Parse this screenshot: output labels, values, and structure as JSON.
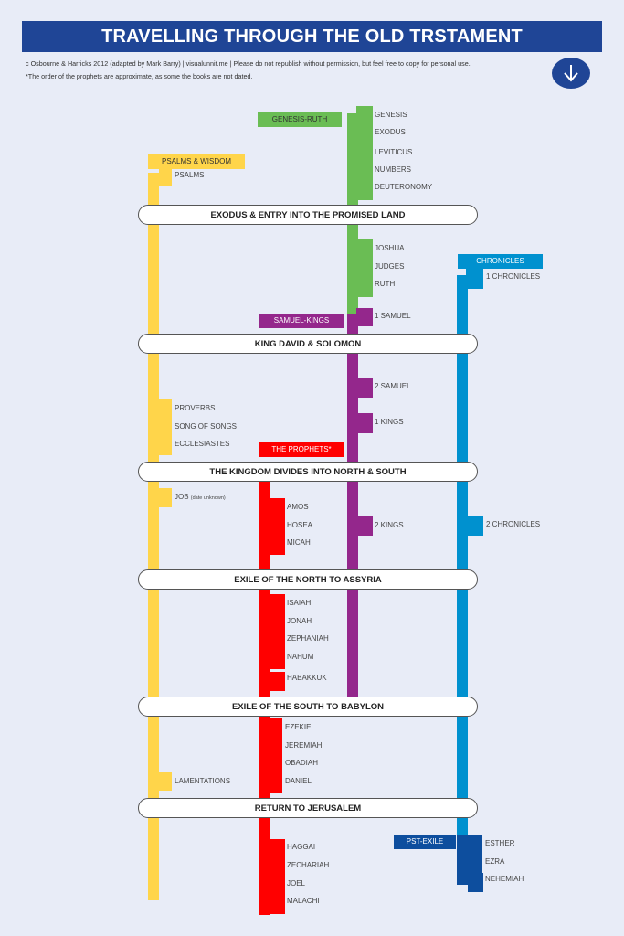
{
  "header": {
    "title": "TRAVELLING THROUGH THE OLD TRSTAMENT",
    "credit": "c Osbourne & Harricks 2012 (adapted by Mark Barry) | visualunnit.me  | Please do not republish without permission, but feel free to copy for personal use.",
    "note": "*The order of the prophets are approximate, as some the books are not dated.",
    "scroll_icon": "arrow-down-circle-icon"
  },
  "colors": {
    "banner": "#1f4596",
    "wisdom": "#ffd54a",
    "genesis_ruth": "#6abd54",
    "samuel_kings": "#94278c",
    "prophets": "#ff0000",
    "chronicles": "#0091cf",
    "post_exile": "#0d4e9e"
  },
  "groups": {
    "genesis_ruth": "GENESIS-RUTH",
    "psalms_wisdom": "PSALMS & WISDOM",
    "chronicles": "CHRONICLES",
    "samuel_kings": "SAMUEL-KINGS",
    "prophets": "THE PROPHETS*",
    "post_exile": "PST-EXILE"
  },
  "events": [
    "EXODUS & ENTRY INTO THE PROMISED LAND",
    "KING DAVID & SOLOMON",
    "THE KINGDOM DIVIDES INTO NORTH & SOUTH",
    "EXILE OF THE NORTH TO ASSYRIA",
    "EXILE OF THE SOUTH TO BABYLON",
    "RETURN TO JERUSALEM"
  ],
  "books": {
    "pentateuch": [
      "GENESIS",
      "EXODUS",
      "LEVITICUS",
      "NUMBERS",
      "DEUTERONOMY"
    ],
    "history": [
      "JOSHUA",
      "JUDGES",
      "RUTH"
    ],
    "samuel_kings": [
      "1 SAMUEL",
      "2 SAMUEL",
      "1 KINGS",
      "2 KINGS"
    ],
    "chronicles": [
      "1 CHRONICLES",
      "2 CHRONICLES"
    ],
    "wisdom": [
      "PSALMS",
      "PROVERBS",
      "SONG OF SONGS",
      "ECCLESIASTES",
      "JOB",
      "LAMENTATIONS"
    ],
    "job_note": "(date unknown)",
    "prophets_north": [
      "AMOS",
      "HOSEA",
      "MICAH"
    ],
    "prophets_assyria": [
      "ISAIAH",
      "JONAH",
      "ZEPHANIAH",
      "NAHUM",
      "HABAKKUK"
    ],
    "prophets_babylon": [
      "EZEKIEL",
      "JEREMIAH",
      "OBADIAH",
      "DANIEL"
    ],
    "prophets_return": [
      "HAGGAI",
      "ZECHARIAH",
      "JOEL",
      "MALACHI"
    ],
    "post_exile": [
      "ESTHER",
      "EZRA",
      "NEHEMIAH"
    ]
  }
}
